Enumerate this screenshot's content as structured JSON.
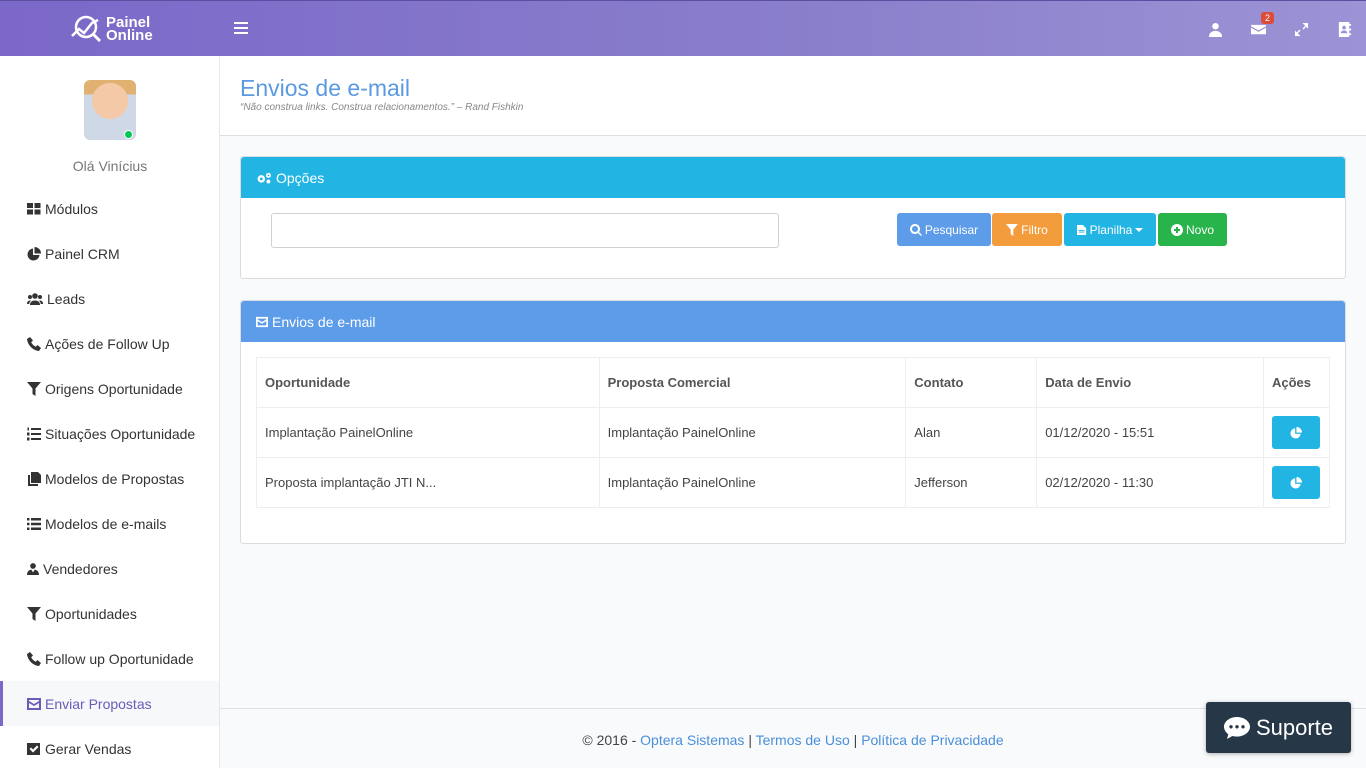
{
  "header": {
    "logo_line1": "Painel",
    "logo_line2": "Online",
    "notification_count": "2",
    "icons": [
      "user-icon",
      "envelope-icon",
      "expand-icon",
      "address-book-icon"
    ]
  },
  "sidebar": {
    "greeting": "Olá Vinícius",
    "items": [
      {
        "label": "Módulos",
        "icon": "grid-icon"
      },
      {
        "label": "Painel CRM",
        "icon": "pie-chart-icon"
      },
      {
        "label": "Leads",
        "icon": "users-icon"
      },
      {
        "label": "Ações de Follow Up",
        "icon": "phone-icon"
      },
      {
        "label": "Origens Oportunidade",
        "icon": "filter-icon"
      },
      {
        "label": "Situações Oportunidade",
        "icon": "list-ol-icon"
      },
      {
        "label": "Modelos de Propostas",
        "icon": "files-icon"
      },
      {
        "label": "Modelos de e-mails",
        "icon": "list-icon"
      },
      {
        "label": "Vendedores",
        "icon": "user-tie-icon"
      },
      {
        "label": "Oportunidades",
        "icon": "filter-icon"
      },
      {
        "label": "Follow up Oportunidade",
        "icon": "phone-icon"
      },
      {
        "label": "Enviar Propostas",
        "icon": "envelope-square-icon"
      },
      {
        "label": "Gerar Vendas",
        "icon": "check-square-icon"
      }
    ]
  },
  "page": {
    "title": "Envios de e-mail",
    "quote": "“Não construa links. Construa relacionamentos.” – Rand Fishkin"
  },
  "options_box": {
    "title": "Opções",
    "search_value": "",
    "buttons": {
      "search": "Pesquisar",
      "filter": "Filtro",
      "sheet": "Planilha",
      "new": "Novo"
    }
  },
  "emails_box": {
    "title": "Envios de e-mail",
    "columns": [
      "Oportunidade",
      "Proposta Comercial",
      "Contato",
      "Data de Envio",
      "Ações"
    ],
    "rows": [
      {
        "opportunity": "Implantação PainelOnline",
        "proposal": "Implantação PainelOnline",
        "contact": "Alan",
        "date": "01/12/2020 - 15:51"
      },
      {
        "opportunity": "Proposta implantação JTI N...",
        "proposal": "Implantação PainelOnline",
        "contact": "Jefferson",
        "date": "02/12/2020 - 11:30"
      }
    ]
  },
  "footer": {
    "copyright": "© 2016 - ",
    "company": "Optera Sistemas",
    "sep": " | ",
    "terms": "Termos de Uso",
    "privacy": "Política de Privacidade"
  },
  "support": {
    "label": "Suporte"
  },
  "colors": {
    "header_start": "#7b68c9",
    "options_head": "#22b5e4",
    "emails_head": "#5c9ce8",
    "filter_button": "#f39c3c",
    "new_button": "#28b44a",
    "support_bg": "#263747"
  }
}
